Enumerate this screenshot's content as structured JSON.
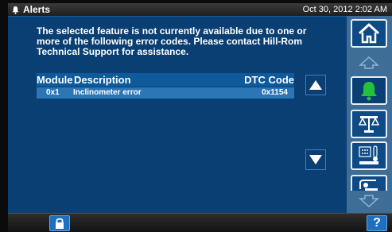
{
  "header": {
    "title": "Alerts",
    "datetime": "Oct 30, 2012 2:02 AM"
  },
  "message": "The selected feature is not currently available due to one or more of the following error codes.  Please contact Hill-Rom Technical Support for assistance.",
  "table": {
    "columns": [
      "Module",
      "Description",
      "DTC Code"
    ],
    "rows": [
      {
        "module": "0x1",
        "description": "Inclinometer error",
        "dtc": "0x1154"
      }
    ]
  },
  "sidebar": {
    "buttons": [
      "home-icon",
      "bell-icon",
      "scale-icon",
      "thermometer-icon",
      "patient-icon"
    ],
    "alert_color": "#22c33a"
  },
  "footer": {
    "help_label": "?"
  },
  "colors": {
    "panel": "#0a3f73",
    "table_header": "#0f5a9a",
    "table_row": "#2d76b5",
    "sidebar": "#3e6d97"
  }
}
